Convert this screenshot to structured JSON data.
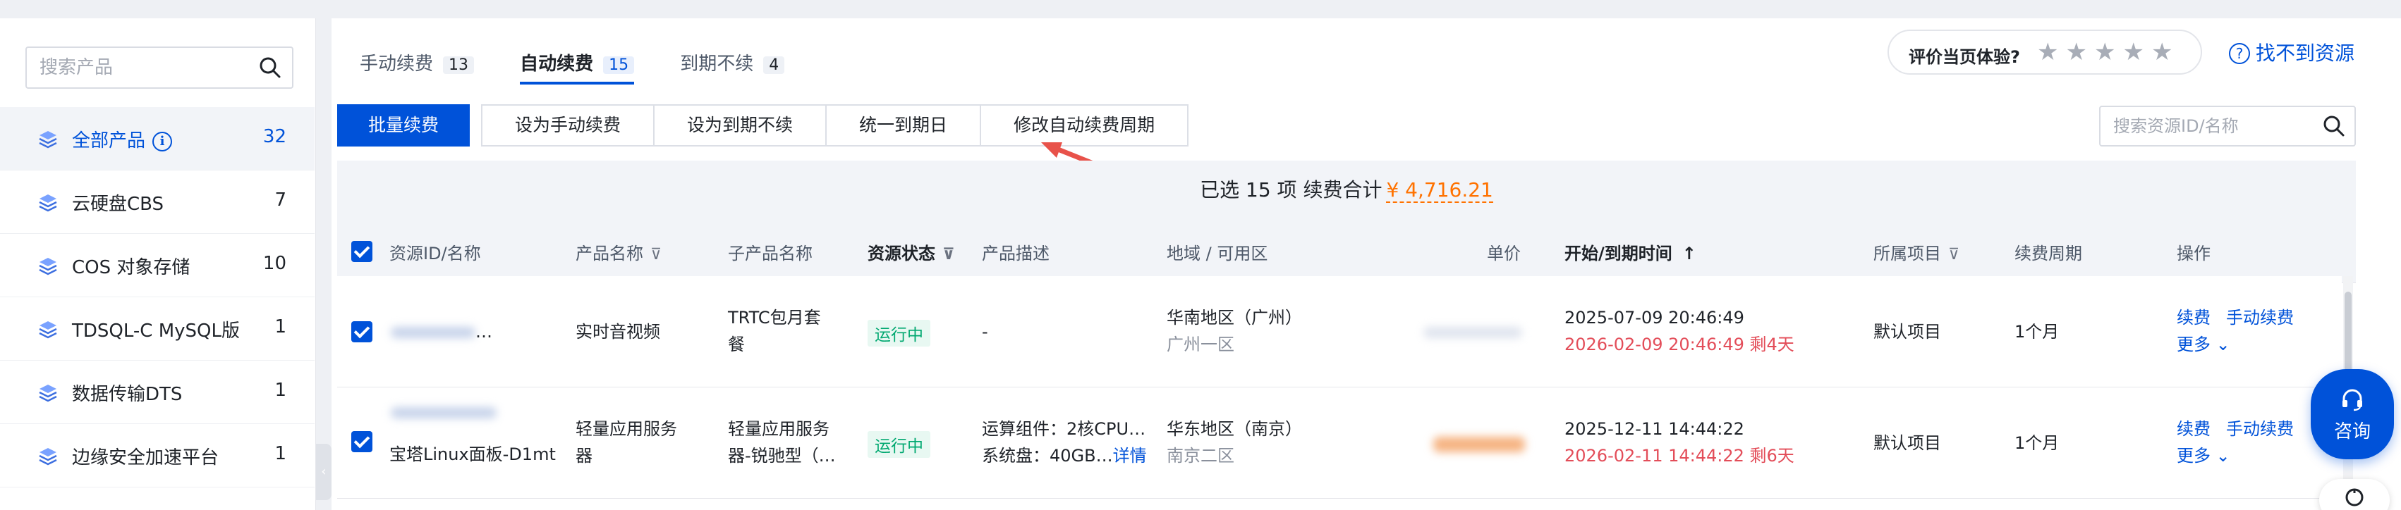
{
  "sidebar": {
    "search_placeholder": "搜索产品",
    "items": [
      {
        "label": "全部产品",
        "count": "32",
        "icon": "product-cube-icon",
        "has_info": true
      },
      {
        "label": "云硬盘CBS",
        "count": "7",
        "icon": "product-cube-icon"
      },
      {
        "label": "COS 对象存储",
        "count": "10",
        "icon": "product-cube-icon"
      },
      {
        "label": "TDSQL-C MySQL版",
        "count": "1",
        "icon": "product-cube-icon"
      },
      {
        "label": "数据传输DTS",
        "count": "1",
        "icon": "product-cube-icon"
      },
      {
        "label": "边缘安全加速平台",
        "count": "1",
        "icon": "product-cube-icon"
      }
    ],
    "info_glyph": "i",
    "collapse_glyph": "‹"
  },
  "tabs": [
    {
      "label": "手动续费",
      "count": "13"
    },
    {
      "label": "自动续费",
      "count": "15"
    },
    {
      "label": "到期不续",
      "count": "4"
    }
  ],
  "rating": {
    "label": "评价当页体验?",
    "stars": [
      "★",
      "★",
      "★",
      "★",
      "★"
    ]
  },
  "help": {
    "icon_glyph": "?",
    "label": "找不到资源"
  },
  "toolbar": {
    "batch_renew": "批量续费",
    "set_manual": "设为手动续费",
    "set_no_renew": "设为到期不续",
    "unify_expiry": "统一到期日",
    "modify_period": "修改自动续费周期"
  },
  "resource_search": {
    "placeholder": "搜索资源ID/名称"
  },
  "summary": {
    "text": "已选 15 项 续费合计",
    "amount": "¥ 4,716.21"
  },
  "table": {
    "headers": {
      "resource": "资源ID/名称",
      "product": "产品名称",
      "subproduct": "子产品名称",
      "status": "资源状态",
      "desc": "产品描述",
      "region": "地域 / 可用区",
      "price": "单价",
      "time": "开始/到期时间",
      "time_sort": "↑",
      "project": "所属项目",
      "period": "续费周期",
      "ops": "操作"
    },
    "filter_glyph": "⊽",
    "rows": [
      {
        "resource_name": "…",
        "product": "实时音视频",
        "sub_line1": "TRTC包月套",
        "sub_line2": "餐",
        "status": "运行中",
        "desc_line1": "-",
        "desc_line2": "",
        "desc_link": "",
        "region": "华南地区（广州）",
        "zone": "广州一区",
        "start": "2025-07-09 20:46:49",
        "end": "2026-02-09 20:46:49 剩4天",
        "project": "默认项目",
        "period": "1个月",
        "op_renew": "续费",
        "op_manual": "手动续费",
        "op_more": "更多 ⌄"
      },
      {
        "resource_name": "宝塔Linux面板-D1mt",
        "product_line1": "轻量应用服务",
        "product_line2": "器",
        "sub_line1": "轻量应用服务",
        "sub_line2": "器-锐驰型（…",
        "status": "运行中",
        "desc_line1": "运算组件：2核CPU…",
        "desc_line2": "系统盘：40GB…",
        "desc_link": "详情",
        "region": "华东地区（南京）",
        "zone": "南京二区",
        "start": "2025-12-11 14:44:22",
        "end": "2026-02-11 14:44:22 剩6天",
        "project": "默认项目",
        "period": "1个月",
        "op_renew": "续费",
        "op_manual": "手动续费",
        "op_more": "更多 ⌄"
      }
    ]
  },
  "consult": {
    "label": "咨询"
  },
  "colors": {
    "primary": "#0052d9",
    "amount": "#ff7200",
    "warning": "#e34d59",
    "running": "#00a870",
    "annotation_arrow": "#e8524a"
  }
}
